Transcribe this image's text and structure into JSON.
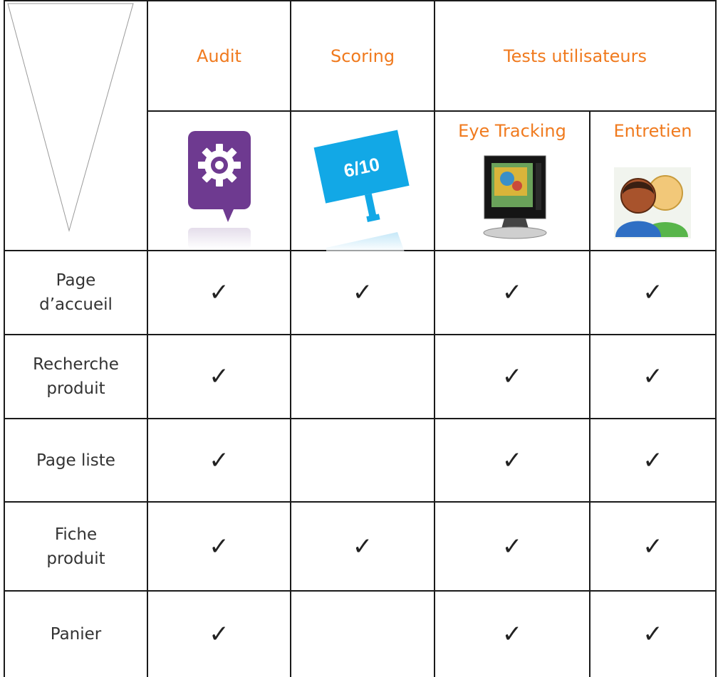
{
  "header": {
    "audit": "Audit",
    "scoring": "Scoring",
    "tests": "Tests utilisateurs",
    "eye_tracking": "Eye Tracking",
    "entretien": "Entretien",
    "score_badge": "6/10"
  },
  "icons": {
    "audit": "gear-icon",
    "scoring": "score-sign-icon",
    "eye_tracking": "monitor-icon",
    "entretien": "users-icon"
  },
  "colors": {
    "accent": "#f07a1e",
    "audit_purple": "#6e3a90",
    "scoring_blue": "#12a8e6"
  },
  "check_mark": "✓",
  "rows": [
    {
      "label_1": "Page",
      "label_2": "d’accueil",
      "audit": true,
      "scoring": true,
      "eye": true,
      "entretien": true
    },
    {
      "label_1": "Recherche",
      "label_2": "produit",
      "audit": true,
      "scoring": false,
      "eye": true,
      "entretien": true
    },
    {
      "label_1": "Page liste",
      "label_2": "",
      "audit": true,
      "scoring": false,
      "eye": true,
      "entretien": true
    },
    {
      "label_1": "Fiche",
      "label_2": "produit",
      "audit": true,
      "scoring": true,
      "eye": true,
      "entretien": true
    },
    {
      "label_1": "Panier",
      "label_2": "",
      "audit": true,
      "scoring": false,
      "eye": true,
      "entretien": true
    }
  ]
}
